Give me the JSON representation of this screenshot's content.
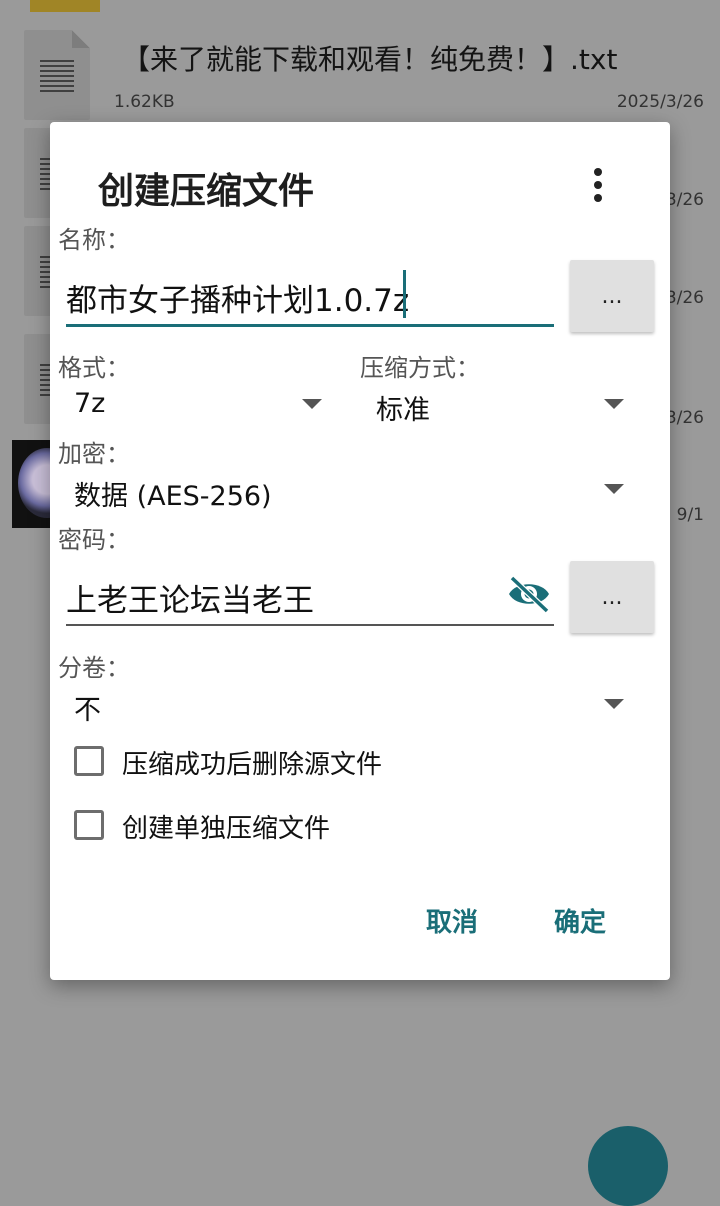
{
  "background": {
    "file_name": "【来了就能下载和观看！纯免费！】.txt",
    "file_size": "1.62KB",
    "dates": [
      "2025/3/26",
      "3/26",
      "3/26",
      "3/26",
      "9/1"
    ]
  },
  "dialog": {
    "title": "创建压缩文件",
    "menu_icon": "more-vert-icon",
    "name_label": "名称：",
    "name_value": "都市女子播种计划1.0.7z",
    "browse_label": "...",
    "format_label": "格式：",
    "format_value": "7z",
    "method_label": "压缩方式：",
    "method_value": "标准",
    "encrypt_label": "加密：",
    "encrypt_value": "数据 (AES-256)",
    "password_label": "密码：",
    "password_value": "上老王论坛当老王",
    "password_eye_icon": "eye-off-icon",
    "volume_label": "分卷：",
    "volume_value": "不",
    "checkbox_delete_label": "压缩成功后删除源文件",
    "checkbox_delete_checked": false,
    "checkbox_single_label": "创建单独压缩文件",
    "checkbox_single_checked": false,
    "cancel_label": "取消",
    "ok_label": "确定"
  },
  "colors": {
    "accent": "#1a6e78",
    "scrim": "#9a9a9a"
  }
}
